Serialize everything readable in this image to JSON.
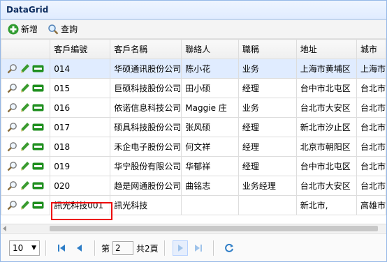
{
  "title": "DataGrid",
  "toolbar": {
    "add_label": "新增",
    "search_label": "查詢"
  },
  "columns": [
    "客戶編號",
    "客戶名稱",
    "聯絡人",
    "職稱",
    "地址",
    "城市"
  ],
  "rows": [
    {
      "id": "014",
      "name": "华硕通讯股份公司",
      "contact": "陈小花",
      "title": "业务",
      "address": "上海市黄埔区",
      "city": "上海市",
      "selected": true
    },
    {
      "id": "015",
      "name": "巨硕科技股份公司",
      "contact": "田小硕",
      "title": "经理",
      "address": "台中市北屯区",
      "city": "台北市",
      "selected": false
    },
    {
      "id": "016",
      "name": "依诺信息科技公司",
      "contact": "Maggie 庄",
      "title": "业务",
      "address": "台北市大安区",
      "city": "台北市",
      "selected": false
    },
    {
      "id": "017",
      "name": "硕具科技股份公司",
      "contact": "张风硕",
      "title": "经理",
      "address": "新北市汐止区",
      "city": "台北市",
      "selected": false
    },
    {
      "id": "018",
      "name": "禾企电子股份公司",
      "contact": "何文祥",
      "title": "经理",
      "address": "北京市朝阳区",
      "city": "台北市",
      "selected": false
    },
    {
      "id": "019",
      "name": "华宁股份有限公司",
      "contact": "华郁祥",
      "title": "经理",
      "address": "台中市北屯区",
      "city": "台北市",
      "selected": false
    },
    {
      "id": "020",
      "name": "趋是网通股份公司",
      "contact": "曲铭志",
      "title": "业务经理",
      "address": "台北市大安区",
      "city": "台北市",
      "selected": false
    },
    {
      "id": "訊光科技001",
      "name": "訊光科技",
      "contact": "",
      "title": "",
      "address": "新北市,",
      "city": "高雄市",
      "selected": false
    }
  ],
  "pager": {
    "page_size": "10",
    "page_label": "第",
    "page_value": "2",
    "total_label": "共2頁"
  },
  "colors": {
    "header_bg": "#e0ecff",
    "selected_row": "#e0ecff",
    "highlight": "#e00000"
  },
  "icons": [
    "zoom-icon",
    "edit-pencil-icon",
    "delete-minus-icon"
  ]
}
